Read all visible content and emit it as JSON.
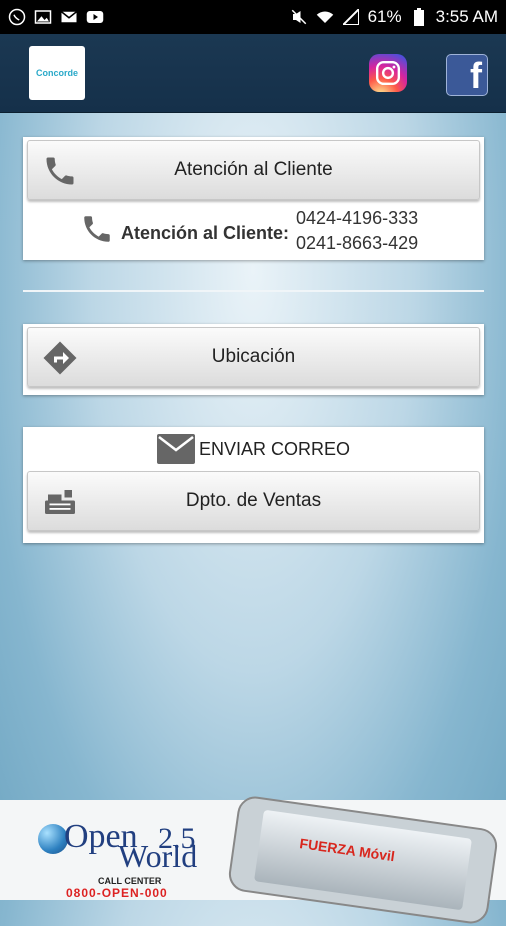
{
  "status_bar": {
    "battery_percent": "61%",
    "time": "3:55 AM",
    "left_icons": [
      "whatsapp-icon",
      "image-icon",
      "mail-icon",
      "youtube-icon"
    ],
    "right_icons": [
      "mute-icon",
      "wifi-icon",
      "signal-icon",
      "battery-icon"
    ]
  },
  "header": {
    "logo_text": "Concorde",
    "social": [
      "instagram-icon",
      "facebook-icon"
    ]
  },
  "customer_service": {
    "button_label": "Atención al Cliente",
    "phone_label": "Atención al Cliente:",
    "phones": [
      "0424-4196-333",
      "0241-8663-429"
    ]
  },
  "location": {
    "button_label": "Ubicación"
  },
  "email": {
    "label": "ENVIAR CORREO",
    "sales_button_label": "Dpto. de Ventas"
  },
  "ad": {
    "brand_top": "Open",
    "brand_num": "2.5",
    "brand_bottom": "World",
    "call_center": "CALL CENTER",
    "phone": "0800-OPEN-000",
    "phone_brand": "FUERZA Móvil"
  },
  "colors": {
    "header_bg": "#1b3852",
    "button_bg": "#e6e6e6",
    "icon_gray": "#666666",
    "page_gradient": "#bcd7e6"
  }
}
